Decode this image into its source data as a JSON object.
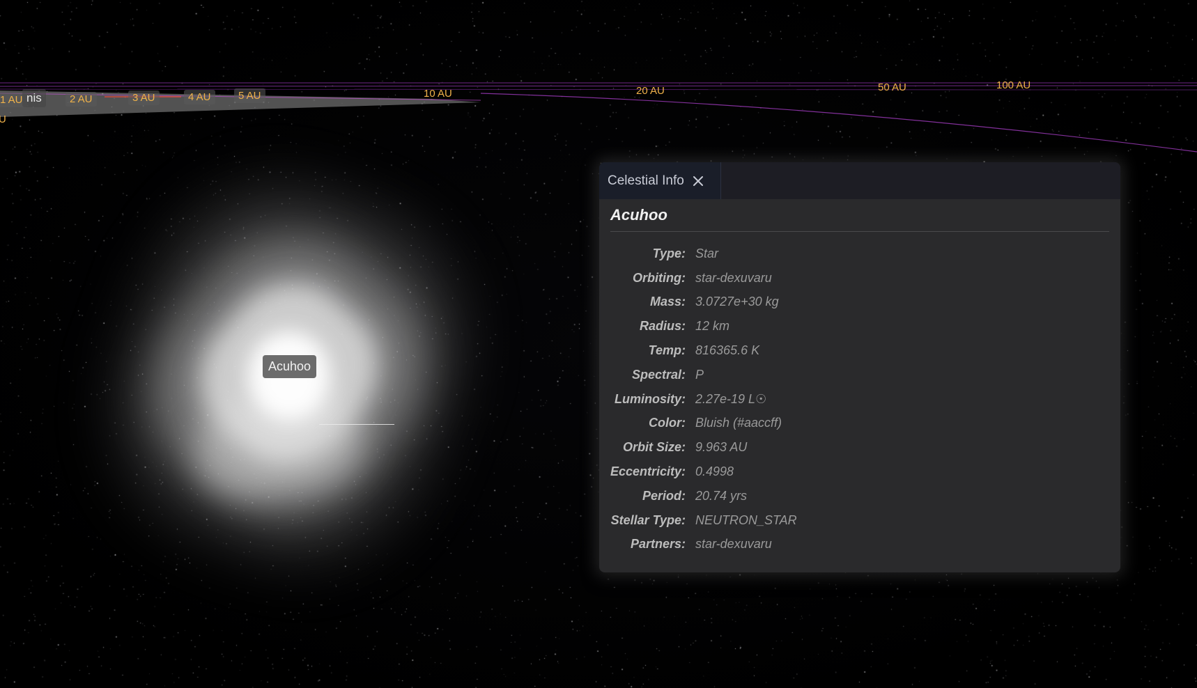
{
  "scale_labels": {
    "au1": "1 AU",
    "au2": "2 AU",
    "au3": "3 AU",
    "au4": "4 AU",
    "au5": "5 AU",
    "au10": "10 AU",
    "au20": "20 AU",
    "au50": "50 AU",
    "au100": "100 AU",
    "partial_left": "U"
  },
  "nearby_body_label": "nis",
  "star": {
    "name": "Acuhoo"
  },
  "panel": {
    "tab_label": "Celestial Info",
    "close_icon": "close-icon",
    "title": "Acuhoo",
    "properties": [
      {
        "key": "Type:",
        "value": "Star"
      },
      {
        "key": "Orbiting:",
        "value": "star-dexuvaru"
      },
      {
        "key": "Mass:",
        "value": "3.0727e+30 kg"
      },
      {
        "key": "Radius:",
        "value": "12 km"
      },
      {
        "key": "Temp:",
        "value": "816365.6 K"
      },
      {
        "key": "Spectral:",
        "value": "P"
      },
      {
        "key": "Luminosity:",
        "value": "2.27e-19 L☉"
      },
      {
        "key": "Color:",
        "value": "Bluish (#aaccff)"
      },
      {
        "key": "Orbit Size:",
        "value": "9.963 AU"
      },
      {
        "key": "Eccentricity:",
        "value": "0.4998"
      },
      {
        "key": "Period:",
        "value": "20.74 yrs"
      },
      {
        "key": "Stellar Type:",
        "value": "NEUTRON_STAR"
      },
      {
        "key": "Partners:",
        "value": "star-dexuvaru"
      }
    ]
  },
  "colors": {
    "scale_label": "#f0b24a",
    "orbit_line": "#a23cc0",
    "panel_bg": "#2a2a2c",
    "tab_bg": "#1a1e29"
  }
}
